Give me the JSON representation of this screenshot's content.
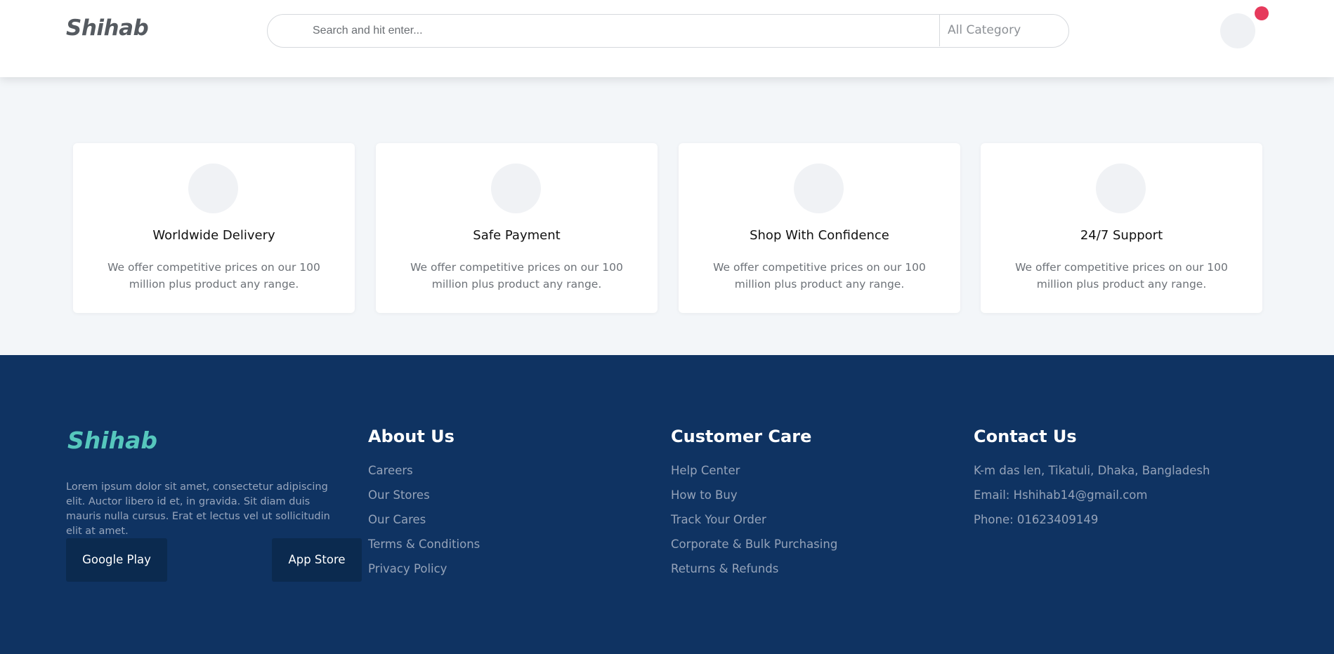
{
  "header": {
    "logo": "Shihab",
    "search_placeholder": "Search and hit enter...",
    "category_label": "All Category"
  },
  "features": [
    {
      "title": "Worldwide Delivery",
      "text": "We offer competitive prices on our 100 million plus product any range."
    },
    {
      "title": "Safe Payment",
      "text": "We offer competitive prices on our 100 million plus product any range."
    },
    {
      "title": "Shop With Confidence",
      "text": "We offer competitive prices on our 100 million plus product any range."
    },
    {
      "title": "24/7 Support",
      "text": "We offer competitive prices on our 100 million plus product any range."
    }
  ],
  "footer": {
    "logo": "Shihab",
    "description": "Lorem ipsum dolor sit amet, consectetur adipiscing elit. Auctor libero id et, in gravida. Sit diam duis mauris nulla cursus. Erat et lectus vel ut sollicitudin elit at amet.",
    "google_play": "Google Play",
    "app_store": "App Store",
    "about": {
      "title": "About Us",
      "links": [
        "Careers",
        "Our Stores",
        "Our Cares",
        "Terms & Conditions",
        "Privacy Policy"
      ]
    },
    "care": {
      "title": "Customer Care",
      "links": [
        "Help Center",
        "How to Buy",
        "Track Your Order",
        "Corporate & Bulk Purchasing",
        "Returns & Refunds"
      ]
    },
    "contact": {
      "title": "Contact Us",
      "lines": [
        "K-m das len, Tikatuli, Dhaka, Bangladesh",
        "Email: Hshihab14@gmail.com",
        "Phone: 01623409149"
      ]
    }
  },
  "colors": {
    "footer_bg": "#0f3362",
    "accent_logo": "#56c7bd",
    "cart_badge": "#e63a5c"
  }
}
